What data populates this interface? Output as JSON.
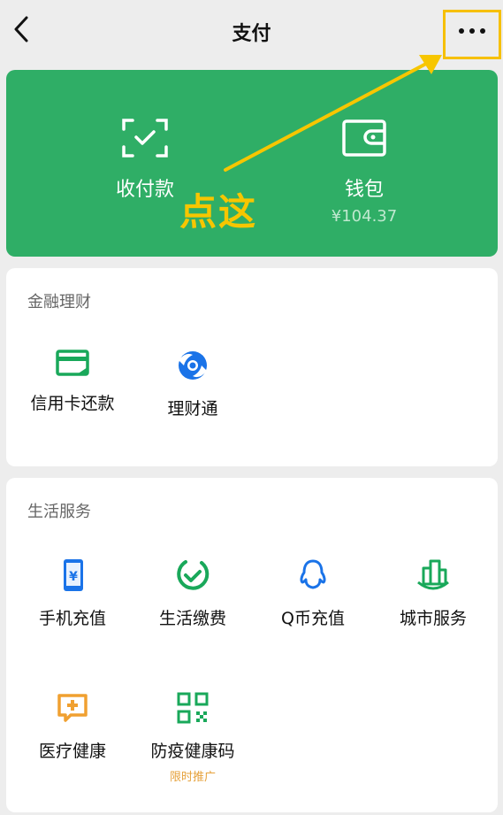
{
  "header": {
    "title": "支付"
  },
  "wallet_panel": {
    "receive_pay_label": "收付款",
    "wallet_label": "钱包",
    "wallet_balance": "¥104.37"
  },
  "finance": {
    "title": "金融理财",
    "items": [
      {
        "label": "信用卡还款",
        "icon": "credit-card-icon"
      },
      {
        "label": "理财通",
        "icon": "licaitong-icon"
      }
    ]
  },
  "life": {
    "title": "生活服务",
    "items": [
      {
        "label": "手机充值",
        "icon": "mobile-phone-icon"
      },
      {
        "label": "生活缴费",
        "icon": "check-circle-icon"
      },
      {
        "label": "Q币充值",
        "icon": "qq-penguin-icon"
      },
      {
        "label": "城市服务",
        "icon": "city-buildings-icon"
      },
      {
        "label": "医疗健康",
        "icon": "medical-chat-icon"
      },
      {
        "label": "防疫健康码",
        "icon": "qr-code-icon",
        "tag": "限时推广"
      }
    ]
  },
  "annotation": {
    "text": "点这"
  },
  "colors": {
    "green": "#2fae66",
    "annotation": "#f7c600",
    "accent_blue": "#1a73e8",
    "accent_green": "#19a85a",
    "accent_orange": "#f0a030"
  }
}
